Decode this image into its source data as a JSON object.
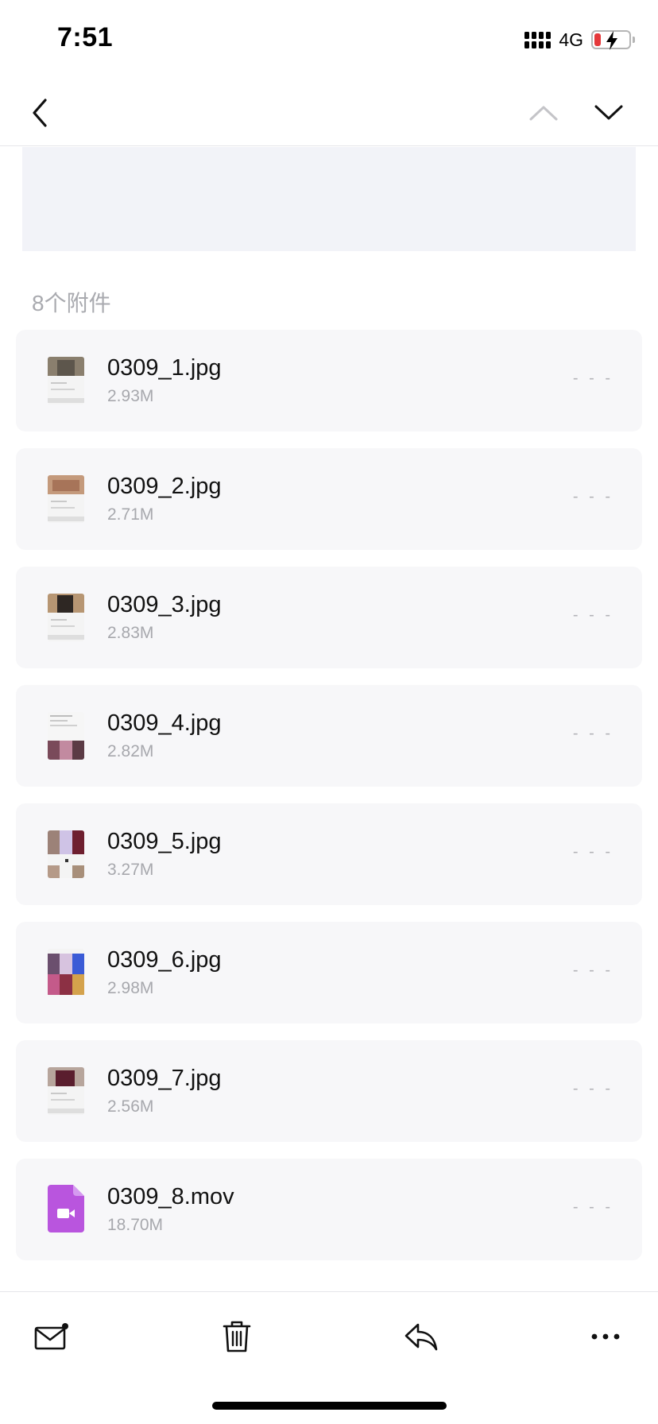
{
  "status": {
    "time": "7:51",
    "network": "4G",
    "battery_level": 0.2,
    "battery_color": "#e5393b"
  },
  "nav": {
    "back_icon": "chevron-left-icon",
    "prev_icon": "chevron-up-icon",
    "next_icon": "chevron-down-icon"
  },
  "attachments": {
    "count_label": "8个附件",
    "more_label": "- - -",
    "items": [
      {
        "name": "0309_1.jpg",
        "size": "2.93M",
        "kind": "image"
      },
      {
        "name": "0309_2.jpg",
        "size": "2.71M",
        "kind": "image"
      },
      {
        "name": "0309_3.jpg",
        "size": "2.83M",
        "kind": "image"
      },
      {
        "name": "0309_4.jpg",
        "size": "2.82M",
        "kind": "image"
      },
      {
        "name": "0309_5.jpg",
        "size": "3.27M",
        "kind": "image"
      },
      {
        "name": "0309_6.jpg",
        "size": "2.98M",
        "kind": "image"
      },
      {
        "name": "0309_7.jpg",
        "size": "2.56M",
        "kind": "image"
      },
      {
        "name": "0309_8.mov",
        "size": "18.70M",
        "kind": "video"
      }
    ]
  },
  "toolbar": {
    "icons": [
      "mail-unread-icon",
      "trash-icon",
      "reply-icon",
      "more-icon"
    ]
  },
  "colors": {
    "video_icon": "#b955de",
    "card_bg": "#f7f7f9"
  }
}
